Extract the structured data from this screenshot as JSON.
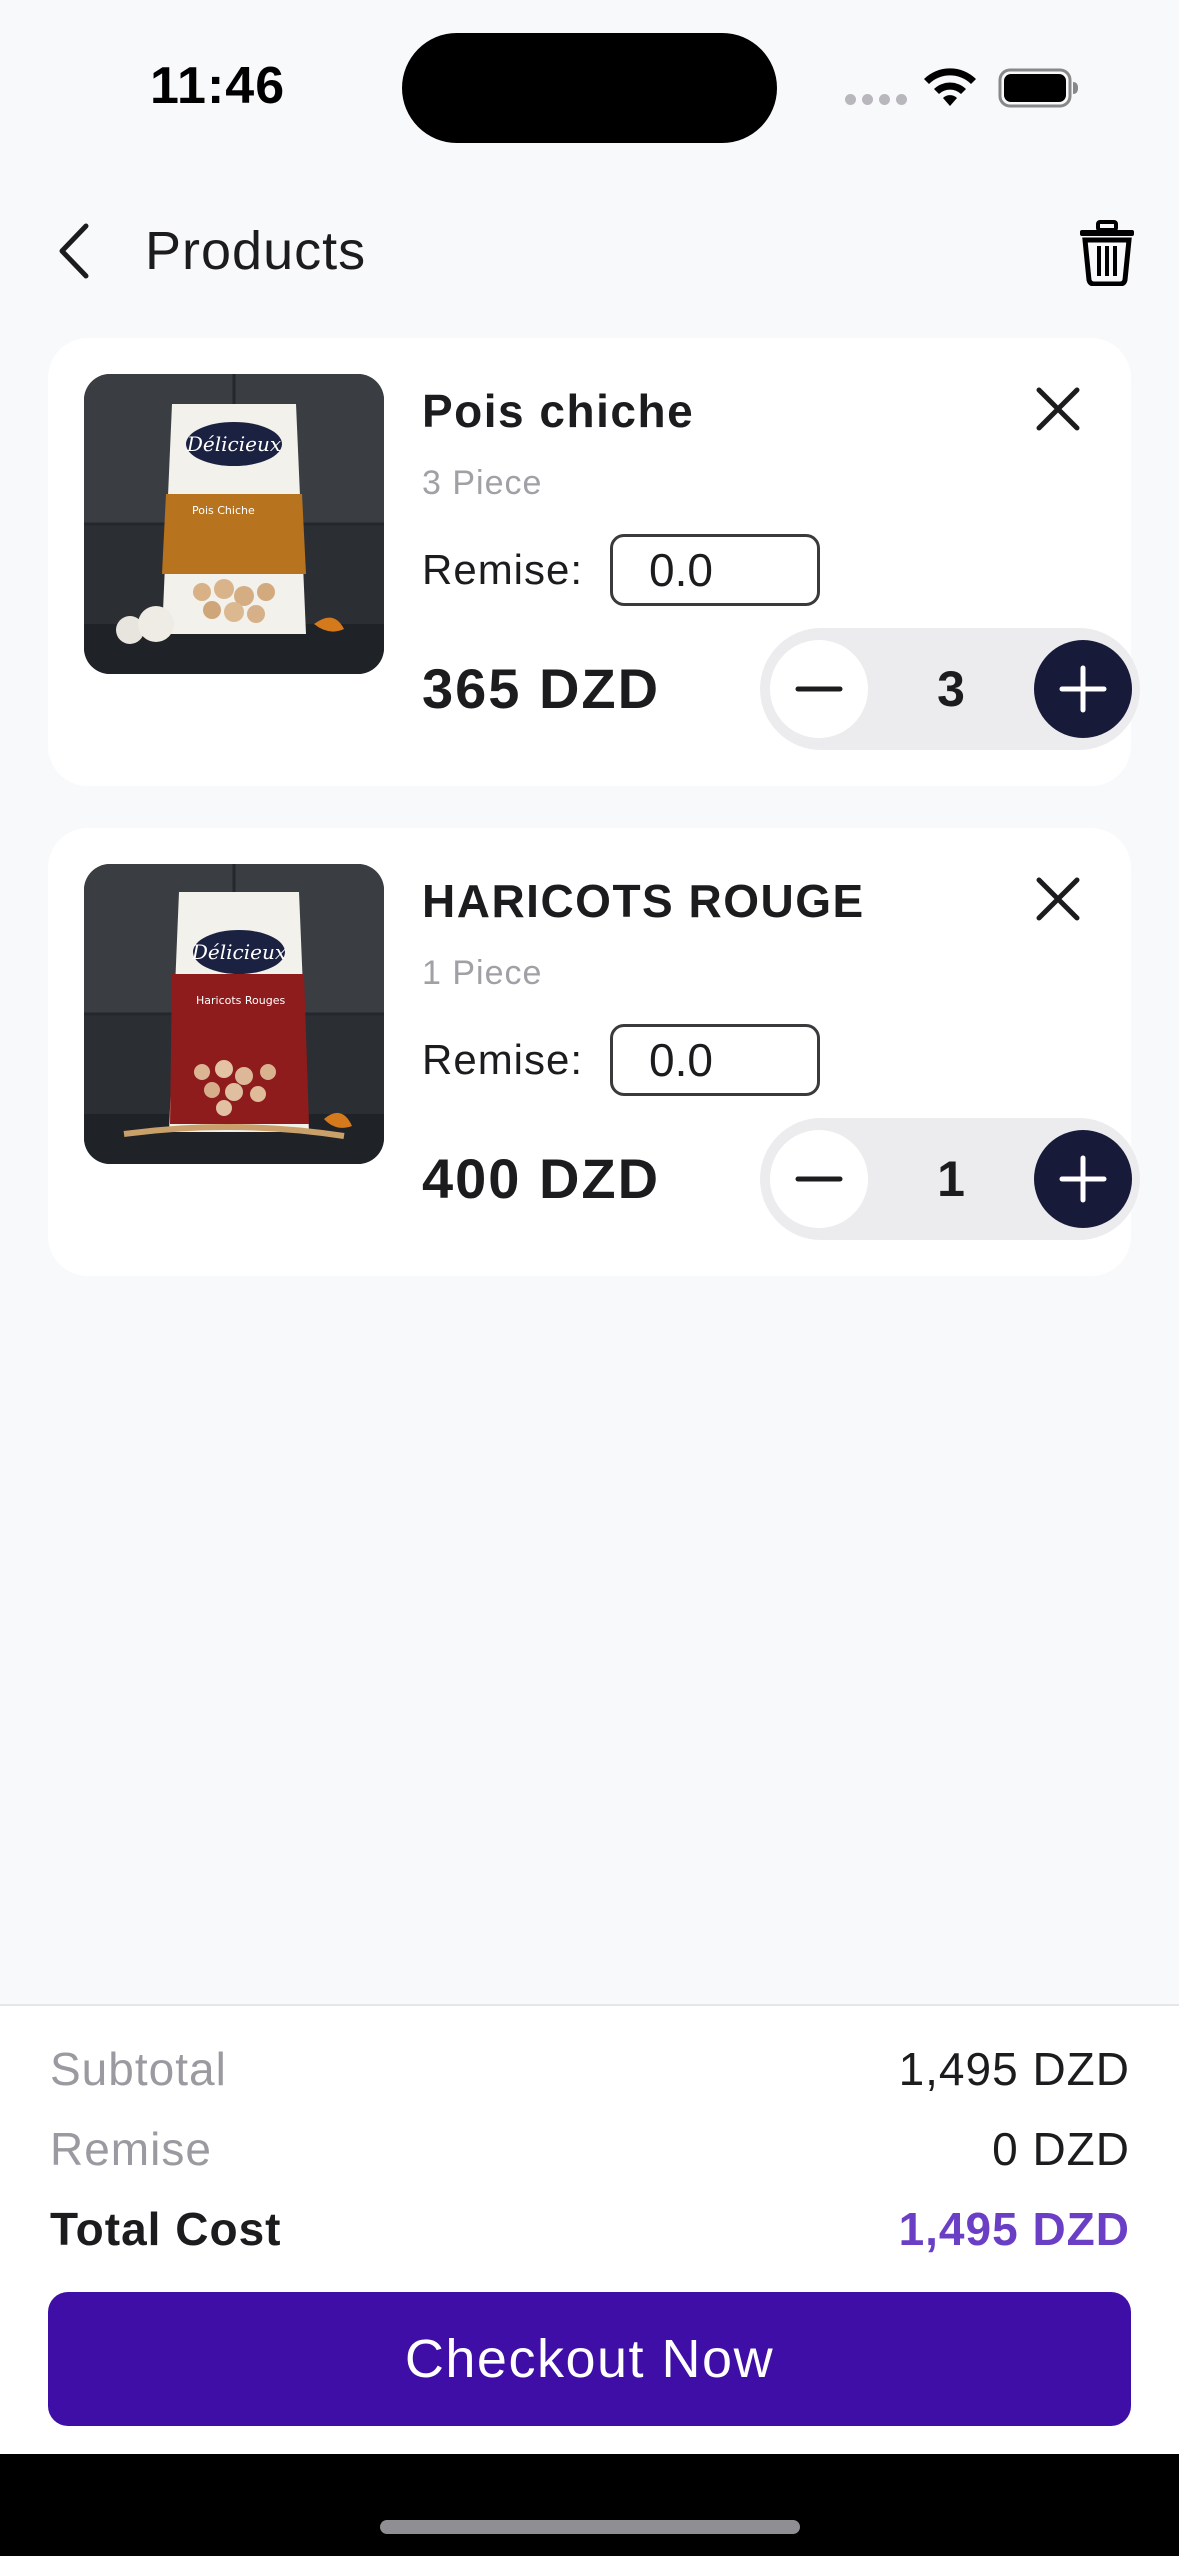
{
  "status_bar": {
    "time": "11:46"
  },
  "header": {
    "title": "Products"
  },
  "cart": {
    "items": [
      {
        "name": "Pois chiche",
        "unit": "3 Piece",
        "remise_label": "Remise:",
        "remise_value": "0.0",
        "price": "365 DZD",
        "quantity": "3",
        "image_brand": "Délicieux",
        "image_label": "Pois Chiche"
      },
      {
        "name": "HARICOTS ROUGE",
        "unit": "1 Piece",
        "remise_label": "Remise:",
        "remise_value": "0.0",
        "price": "400 DZD",
        "quantity": "1",
        "image_brand": "Délicieux",
        "image_label": "Haricots Rouges"
      }
    ]
  },
  "summary": {
    "subtotal_label": "Subtotal",
    "subtotal_value": "1,495 DZD",
    "remise_label": "Remise",
    "remise_value": "0 DZD",
    "total_label": "Total Cost",
    "total_value": "1,495 DZD",
    "checkout_label": "Checkout Now"
  },
  "icons": {
    "back": "chevron-left-icon",
    "trash": "trash-icon",
    "remove": "close-icon",
    "minus": "minus-icon",
    "plus": "plus-icon"
  },
  "colors": {
    "accent": "#3e0ea6",
    "total": "#6a3fc6",
    "stepper_plus": "#181a3a",
    "background": "#f8f9fb"
  }
}
